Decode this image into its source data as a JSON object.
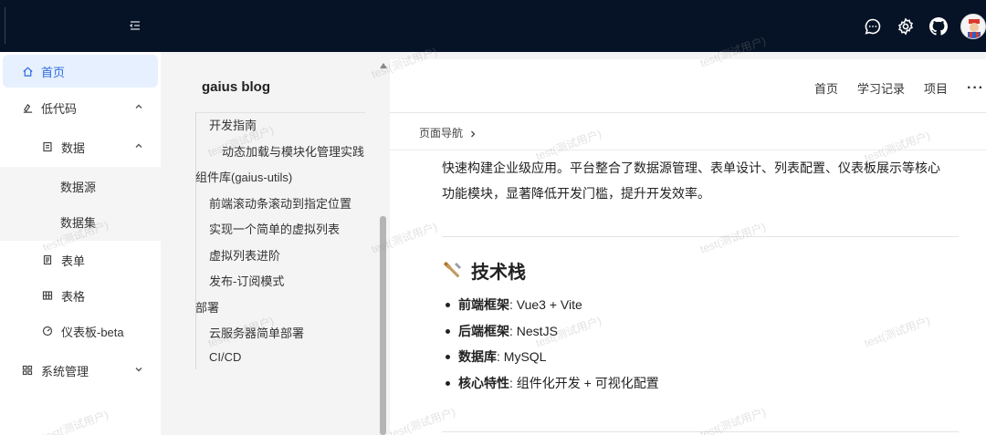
{
  "topbar": {
    "icons": [
      "collapse-menu-icon",
      "chat-icon",
      "gear-icon",
      "github-icon"
    ],
    "avatar": "user-avatar"
  },
  "sidebar": {
    "items": [
      {
        "label": "首页",
        "icon": "home-icon",
        "active": true
      },
      {
        "label": "低代码",
        "icon": "lowcode-icon",
        "expanded": true
      },
      {
        "label": "数据",
        "icon": "data-icon",
        "expanded": true
      },
      {
        "label": "数据源"
      },
      {
        "label": "数据集"
      },
      {
        "label": "表单",
        "icon": "form-icon"
      },
      {
        "label": "表格",
        "icon": "table-icon"
      },
      {
        "label": "仪表板-beta",
        "icon": "dashboard-icon"
      },
      {
        "label": "系统管理",
        "icon": "system-icon",
        "expanded": false
      }
    ]
  },
  "toc": {
    "title": "gaius blog",
    "items": [
      "开发指南",
      "动态加载与模块化管理实践",
      "组件库(gaius-utils)",
      "前端滚动条滚动到指定位置",
      "实现一个简单的虚拟列表",
      "虚拟列表进阶",
      "发布-订阅模式",
      "部署",
      "云服务器简单部署",
      "CI/CD"
    ]
  },
  "header_nav": {
    "links": [
      "首页",
      "学习记录",
      "项目"
    ],
    "more": "···"
  },
  "breadcrumb": {
    "label": "页面导航"
  },
  "content": {
    "intro_line1": "快速构建企业级应用。平台整合了数据源管理、表单设计、列表配置、仪表板展示等核心",
    "intro_line2": "功能模块，显著降低开发门槛，提升开发效率。",
    "tech_heading": "技术栈",
    "tech_items": [
      {
        "key": "前端框架",
        "value": ": Vue3 + Vite"
      },
      {
        "key": "后端框架",
        "value": ": NestJS"
      },
      {
        "key": "数据库",
        "value": ": MySQL"
      },
      {
        "key": "核心特性",
        "value": ": 组件化开发 + 可视化配置"
      }
    ]
  },
  "watermark": {
    "text": "test(测试用户)"
  },
  "colors": {
    "topbar_bg": "#061326",
    "accent": "#2f6bde",
    "active_bg": "#e6f0ff"
  }
}
